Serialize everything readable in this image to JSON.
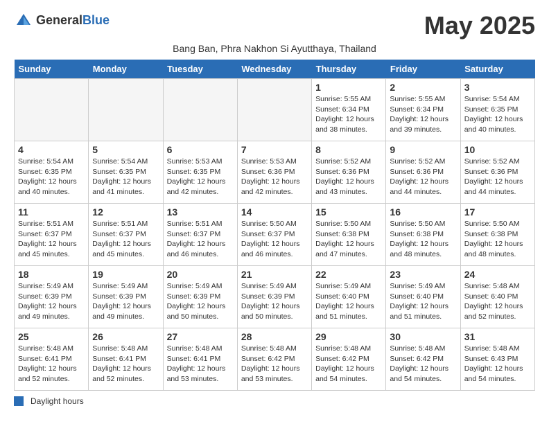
{
  "header": {
    "logo_general": "General",
    "logo_blue": "Blue",
    "month_title": "May 2025",
    "subtitle": "Bang Ban, Phra Nakhon Si Ayutthaya, Thailand"
  },
  "columns": [
    "Sunday",
    "Monday",
    "Tuesday",
    "Wednesday",
    "Thursday",
    "Friday",
    "Saturday"
  ],
  "weeks": [
    [
      {
        "day": "",
        "info": ""
      },
      {
        "day": "",
        "info": ""
      },
      {
        "day": "",
        "info": ""
      },
      {
        "day": "",
        "info": ""
      },
      {
        "day": "1",
        "info": "Sunrise: 5:55 AM\nSunset: 6:34 PM\nDaylight: 12 hours\nand 38 minutes."
      },
      {
        "day": "2",
        "info": "Sunrise: 5:55 AM\nSunset: 6:34 PM\nDaylight: 12 hours\nand 39 minutes."
      },
      {
        "day": "3",
        "info": "Sunrise: 5:54 AM\nSunset: 6:35 PM\nDaylight: 12 hours\nand 40 minutes."
      }
    ],
    [
      {
        "day": "4",
        "info": "Sunrise: 5:54 AM\nSunset: 6:35 PM\nDaylight: 12 hours\nand 40 minutes."
      },
      {
        "day": "5",
        "info": "Sunrise: 5:54 AM\nSunset: 6:35 PM\nDaylight: 12 hours\nand 41 minutes."
      },
      {
        "day": "6",
        "info": "Sunrise: 5:53 AM\nSunset: 6:35 PM\nDaylight: 12 hours\nand 42 minutes."
      },
      {
        "day": "7",
        "info": "Sunrise: 5:53 AM\nSunset: 6:36 PM\nDaylight: 12 hours\nand 42 minutes."
      },
      {
        "day": "8",
        "info": "Sunrise: 5:52 AM\nSunset: 6:36 PM\nDaylight: 12 hours\nand 43 minutes."
      },
      {
        "day": "9",
        "info": "Sunrise: 5:52 AM\nSunset: 6:36 PM\nDaylight: 12 hours\nand 44 minutes."
      },
      {
        "day": "10",
        "info": "Sunrise: 5:52 AM\nSunset: 6:36 PM\nDaylight: 12 hours\nand 44 minutes."
      }
    ],
    [
      {
        "day": "11",
        "info": "Sunrise: 5:51 AM\nSunset: 6:37 PM\nDaylight: 12 hours\nand 45 minutes."
      },
      {
        "day": "12",
        "info": "Sunrise: 5:51 AM\nSunset: 6:37 PM\nDaylight: 12 hours\nand 45 minutes."
      },
      {
        "day": "13",
        "info": "Sunrise: 5:51 AM\nSunset: 6:37 PM\nDaylight: 12 hours\nand 46 minutes."
      },
      {
        "day": "14",
        "info": "Sunrise: 5:50 AM\nSunset: 6:37 PM\nDaylight: 12 hours\nand 46 minutes."
      },
      {
        "day": "15",
        "info": "Sunrise: 5:50 AM\nSunset: 6:38 PM\nDaylight: 12 hours\nand 47 minutes."
      },
      {
        "day": "16",
        "info": "Sunrise: 5:50 AM\nSunset: 6:38 PM\nDaylight: 12 hours\nand 48 minutes."
      },
      {
        "day": "17",
        "info": "Sunrise: 5:50 AM\nSunset: 6:38 PM\nDaylight: 12 hours\nand 48 minutes."
      }
    ],
    [
      {
        "day": "18",
        "info": "Sunrise: 5:49 AM\nSunset: 6:39 PM\nDaylight: 12 hours\nand 49 minutes."
      },
      {
        "day": "19",
        "info": "Sunrise: 5:49 AM\nSunset: 6:39 PM\nDaylight: 12 hours\nand 49 minutes."
      },
      {
        "day": "20",
        "info": "Sunrise: 5:49 AM\nSunset: 6:39 PM\nDaylight: 12 hours\nand 50 minutes."
      },
      {
        "day": "21",
        "info": "Sunrise: 5:49 AM\nSunset: 6:39 PM\nDaylight: 12 hours\nand 50 minutes."
      },
      {
        "day": "22",
        "info": "Sunrise: 5:49 AM\nSunset: 6:40 PM\nDaylight: 12 hours\nand 51 minutes."
      },
      {
        "day": "23",
        "info": "Sunrise: 5:49 AM\nSunset: 6:40 PM\nDaylight: 12 hours\nand 51 minutes."
      },
      {
        "day": "24",
        "info": "Sunrise: 5:48 AM\nSunset: 6:40 PM\nDaylight: 12 hours\nand 52 minutes."
      }
    ],
    [
      {
        "day": "25",
        "info": "Sunrise: 5:48 AM\nSunset: 6:41 PM\nDaylight: 12 hours\nand 52 minutes."
      },
      {
        "day": "26",
        "info": "Sunrise: 5:48 AM\nSunset: 6:41 PM\nDaylight: 12 hours\nand 52 minutes."
      },
      {
        "day": "27",
        "info": "Sunrise: 5:48 AM\nSunset: 6:41 PM\nDaylight: 12 hours\nand 53 minutes."
      },
      {
        "day": "28",
        "info": "Sunrise: 5:48 AM\nSunset: 6:42 PM\nDaylight: 12 hours\nand 53 minutes."
      },
      {
        "day": "29",
        "info": "Sunrise: 5:48 AM\nSunset: 6:42 PM\nDaylight: 12 hours\nand 54 minutes."
      },
      {
        "day": "30",
        "info": "Sunrise: 5:48 AM\nSunset: 6:42 PM\nDaylight: 12 hours\nand 54 minutes."
      },
      {
        "day": "31",
        "info": "Sunrise: 5:48 AM\nSunset: 6:43 PM\nDaylight: 12 hours\nand 54 minutes."
      }
    ]
  ],
  "footer": {
    "legend_label": "Daylight hours"
  }
}
